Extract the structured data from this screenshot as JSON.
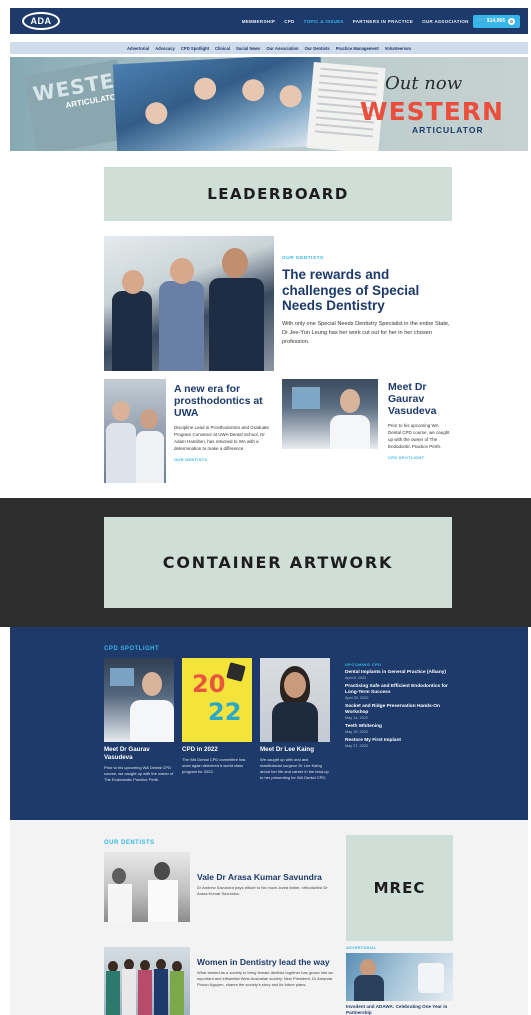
{
  "header": {
    "logo": "ADA",
    "nav": [
      "MEMBERSHIP",
      "CPD",
      "TOPIC & ISSUES",
      "PARTNERS IN PRACTICE",
      "OUR ASSOCIATION"
    ],
    "cart_total": "$14,965",
    "cart_count": "0"
  },
  "subnav": [
    "Advertorial",
    "Advocacy",
    "CPD Spotlight",
    "Clinical",
    "Social News",
    "Our Association",
    "Our Dentists",
    "Practice Management",
    "Volunteerism"
  ],
  "hero": {
    "left_title": "WESTERN",
    "left_sub": "ARTICULATOR",
    "out_now": "Out now",
    "title": "WESTERN",
    "subtitle": "ARTICULATOR"
  },
  "ads": {
    "leaderboard": "LEADERBOARD",
    "container": "CONTAINER ARTWORK",
    "mrec": "MREC"
  },
  "feature": {
    "kicker": "OUR DENTISTS",
    "title": "The rewards and challenges of Special Needs Dentistry",
    "excerpt": "With only one Special Needs Dentistry Specialist in the entire State, Dr Jee-Yun Leung has her work cut out for her in her chosen profession."
  },
  "cards": [
    {
      "title": "A new era for prosthodontics at UWA",
      "excerpt": "Discipline Lead in Prosthodontics and Graduate Program Convenor at UWA Dental School, Dr Adam Hamilton, has returned to WA with a determination to make a difference.",
      "kicker": "OUR DENTISTS"
    },
    {
      "title": "Meet Dr Gaurav Vasudeva",
      "excerpt": "Prior to his upcoming WA Dental CPD course, we caught up with the owner of The Endodontic Practice Perth.",
      "kicker": "CPD SPOTLIGHT"
    }
  ],
  "cpd": {
    "title": "CPD SPOTLIGHT",
    "cards": [
      {
        "title": "Meet Dr Gaurav Vasudeva",
        "excerpt": "Prior to his upcoming WA Dental CPD course, we caught up with the owner of The Endodontic Practice Perth."
      },
      {
        "title": "CPD in 2022",
        "excerpt": "The WA Dental CPD committee has once again delivered a world class program for 2022.",
        "poster_top": "20",
        "poster_bottom": "22"
      },
      {
        "title": "Meet Dr Lee Kaing",
        "excerpt": "We caught up with oral and maxillofacial surgeon Dr Lee Kaing about her life and career in the lead-up to her presenting for WA Dental CPD."
      }
    ],
    "upcoming_title": "UPCOMING CPD",
    "events": [
      {
        "name": "Dental Implants in General Practice (Albany)",
        "date": "April 8, 2022"
      },
      {
        "name": "Practising Safe and Efficient Endodontics for Long-Term Success",
        "date": "April 30, 2022"
      },
      {
        "name": "Socket and Ridge Preservation Hands-On Workshop",
        "date": "May 14, 2022"
      },
      {
        "name": "Teeth Whitening",
        "date": "May 19, 2022"
      },
      {
        "name": "Restore My First Implant",
        "date": "May 27, 2022"
      }
    ]
  },
  "our_dentists": {
    "title": "OUR DENTISTS",
    "items": [
      {
        "title": "Vale Dr Arasa Kumar Savundra",
        "excerpt": "Dr Andrew Savundra pays tribute to his much-loved father, orthodontist Dr Arasa Kumar Savundra."
      },
      {
        "title": "Women in Dentistry lead the way",
        "excerpt": "What started as a society to bring female dentists together has grown into an important and influential West Australian society. New President, Dr Amanda Phoon Nguyen, shares the society's story and its future plans."
      }
    ],
    "advertorial_kicker": "ADVERTORIAL",
    "advertorial_title": "Invodent and ADAWA: Celebrating One Year in Partnership"
  }
}
